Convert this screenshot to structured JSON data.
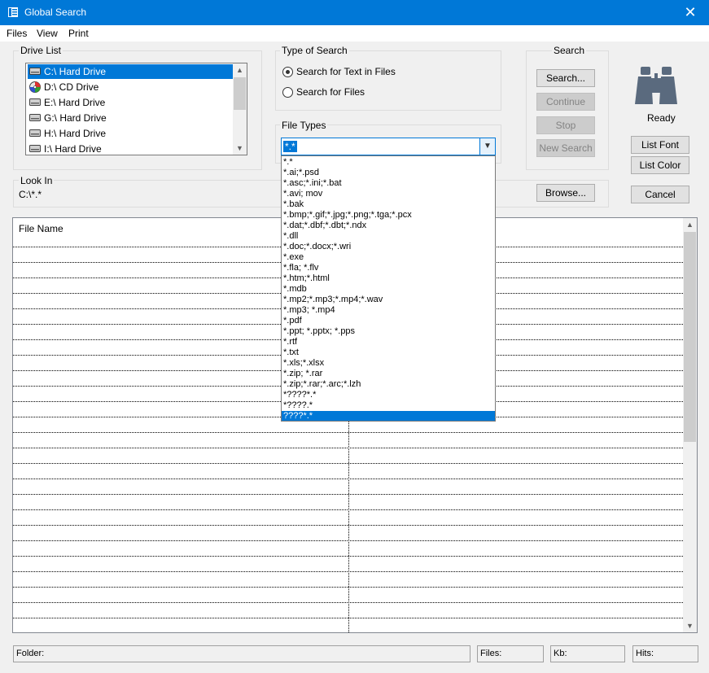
{
  "window": {
    "title": "Global Search",
    "close_glyph": "✕"
  },
  "menu": [
    "Files",
    "View",
    "Print"
  ],
  "drive_list": {
    "label": "Drive List",
    "items": [
      {
        "label": "C:\\ Hard Drive",
        "icon": "hard-drive-icon",
        "selected": true
      },
      {
        "label": "D:\\ CD Drive",
        "icon": "cd-drive-icon",
        "selected": false
      },
      {
        "label": "E:\\ Hard Drive",
        "icon": "hard-drive-icon",
        "selected": false
      },
      {
        "label": "G:\\ Hard Drive",
        "icon": "hard-drive-icon",
        "selected": false
      },
      {
        "label": "H:\\ Hard Drive",
        "icon": "hard-drive-icon",
        "selected": false
      },
      {
        "label": "I:\\ Hard Drive",
        "icon": "hard-drive-icon",
        "selected": false
      }
    ]
  },
  "type_of_search": {
    "label": "Type of Search",
    "options": [
      {
        "label": "Search for Text in Files",
        "checked": true
      },
      {
        "label": "Search for Files",
        "checked": false
      }
    ]
  },
  "file_types": {
    "label": "File Types",
    "selected": "*.*",
    "options": [
      "*.*",
      "*.ai;*.psd",
      "*.asc;*.ini;*.bat",
      "*.avi; mov",
      "*.bak",
      "*.bmp;*.gif;*.jpg;*.png;*.tga;*.pcx",
      "*.dat;*.dbf;*.dbt;*.ndx",
      "*.dll",
      "*.doc;*.docx;*.wri",
      "*.exe",
      "*.fla; *.flv",
      "*.htm;*.html",
      "*.mdb",
      "*.mp2;*.mp3;*.mp4;*.wav",
      "*.mp3; *.mp4",
      "*.pdf",
      "*.ppt; *.pptx; *.pps",
      "*.rtf",
      "*.txt",
      "*.xls;*.xlsx",
      "*.zip; *.rar",
      "*.zip;*.rar;*.arc;*.lzh",
      "*????*.*",
      "*????.*",
      "????*.*"
    ],
    "highlighted_index": 24
  },
  "search_panel": {
    "label": "Search",
    "search": "Search...",
    "continue": "Continue",
    "stop": "Stop",
    "new_search": "New Search"
  },
  "status": {
    "ready": "Ready",
    "icon": "binoculars-icon"
  },
  "side_buttons": {
    "list_font": "List Font",
    "list_color": "List Color",
    "cancel": "Cancel"
  },
  "look_in": {
    "label": "Look In",
    "value": "C:\\*.*",
    "browse": "Browse..."
  },
  "file_list": {
    "header": "File Name"
  },
  "statusbar": {
    "folder": "Folder:",
    "files": "Files:",
    "kb": "Kb:",
    "hits": "Hits:"
  },
  "colors": {
    "titlebar": "#0078d7",
    "selection": "#0078d7",
    "background": "#f0f0f0"
  }
}
